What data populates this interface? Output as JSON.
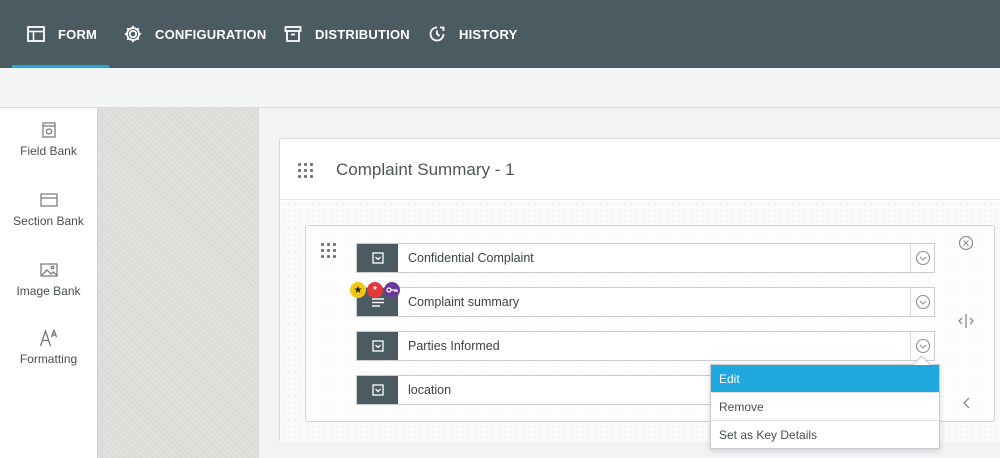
{
  "nav": {
    "tabs": [
      {
        "label": "FORM",
        "icon": "form-table-icon",
        "active": true
      },
      {
        "label": "CONFIGURATION",
        "icon": "gear-icon",
        "active": false
      },
      {
        "label": "DISTRIBUTION",
        "icon": "archive-box-icon",
        "active": false
      },
      {
        "label": "HISTORY",
        "icon": "history-clock-icon",
        "active": false
      }
    ],
    "accent_color": "#1fa8de",
    "bar_color": "#4c5a62"
  },
  "sidebar": {
    "items": [
      {
        "label": "Field Bank",
        "icon": "field-bank-icon"
      },
      {
        "label": "Section Bank",
        "icon": "section-bank-icon"
      },
      {
        "label": "Image Bank",
        "icon": "image-icon"
      },
      {
        "label": "Formatting",
        "icon": "font-formatting-icon"
      }
    ]
  },
  "section": {
    "title": "Complaint Summary - 1"
  },
  "fields": [
    {
      "label": "Confidential Complaint",
      "icon": "dropdown-field-icon"
    },
    {
      "label": "Complaint summary",
      "icon": "text-field-icon"
    },
    {
      "label": "Parties Informed",
      "icon": "dropdown-field-icon"
    },
    {
      "label": "location",
      "icon": "dropdown-field-icon"
    }
  ],
  "badges": [
    {
      "icon": "star-icon",
      "symbol": "★",
      "color": "#f2c811"
    },
    {
      "icon": "required-asterisk-icon",
      "symbol": "*",
      "color": "#e03a3a"
    },
    {
      "icon": "key-icon",
      "symbol": "",
      "color": "#6a3a9a"
    }
  ],
  "context_menu": {
    "items": [
      {
        "label": "Edit",
        "active": true
      },
      {
        "label": "Remove",
        "active": false
      },
      {
        "label": "Set as Key Details",
        "active": false
      }
    ],
    "highlight_color": "#1fa8de"
  }
}
